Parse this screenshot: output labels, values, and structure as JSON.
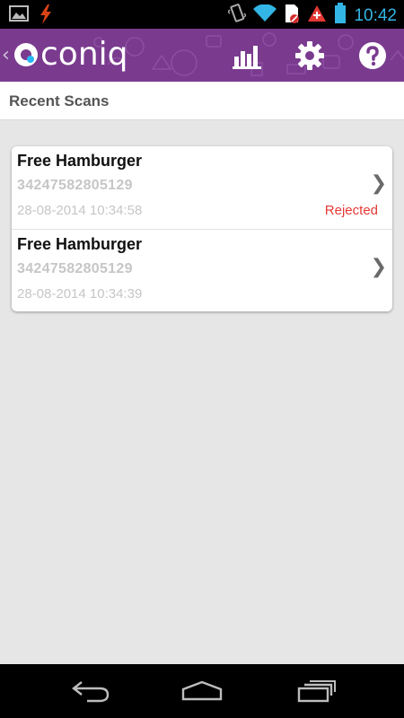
{
  "status_bar": {
    "time": "10:42",
    "icons": [
      "gallery-icon",
      "flash-icon",
      "vibrate-icon",
      "wifi-icon",
      "sim-blocked-icon",
      "alert-icon",
      "battery-icon"
    ]
  },
  "app_bar": {
    "logo_text": "coniq",
    "back_glyph": "‹",
    "actions": [
      "stats-icon",
      "settings-gear-icon",
      "help-icon"
    ],
    "brand_color": "#7a3b8f"
  },
  "section": {
    "title": "Recent Scans"
  },
  "scans": [
    {
      "name": "Free Hamburger",
      "code": "34247582805129",
      "datetime": "28-08-2014 10:34:58",
      "status": "Rejected",
      "arrow": "❯"
    },
    {
      "name": "Free Hamburger",
      "code": "34247582805129",
      "datetime": "28-08-2014 10:34:39",
      "status": "",
      "arrow": "❯"
    }
  ],
  "nav_bar": {
    "buttons": [
      "back-icon",
      "home-icon",
      "recent-apps-icon"
    ]
  },
  "colors": {
    "status_accent": "#33b5e5",
    "rejected": "#e53935"
  }
}
